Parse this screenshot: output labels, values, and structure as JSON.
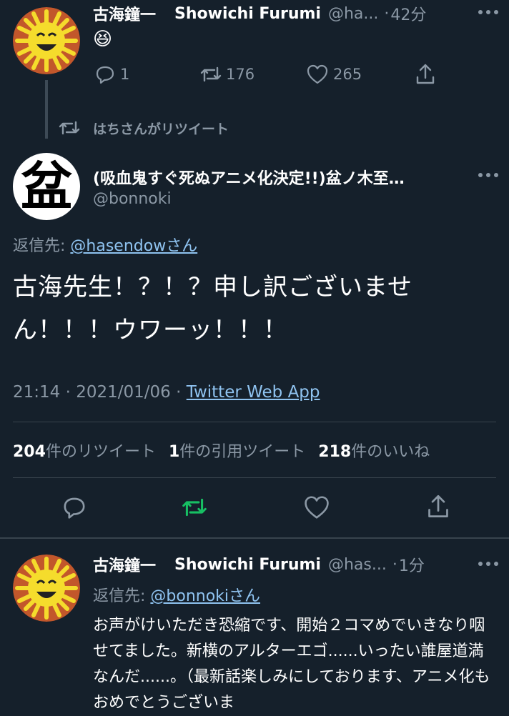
{
  "tweet1": {
    "author_name": "古海鐘一",
    "author_en": "Showichi Furumi",
    "handle": "@ha...",
    "sep": "·",
    "time": "42分",
    "text": "😆",
    "replies": "1",
    "retweets": "176",
    "likes": "265"
  },
  "retweet_banner": {
    "text": "はちさんがリツイート"
  },
  "main_tweet": {
    "author_name": "(吸血鬼すぐ死ぬアニメ化決定!!)盆ノ木至…",
    "handle": "@bonnoki",
    "avatar_char": "盆",
    "reply_prefix": "返信先: ",
    "reply_to": "@hasendowさん",
    "text": "古海先生！？！？申し訳ございません！！！ウワーッ！！！",
    "timestamp": "21:14 · 2021/01/06 · ",
    "source": "Twitter Web App",
    "stats": {
      "retweet_count": "204",
      "retweet_label": "件のリツイート",
      "quote_count": "1",
      "quote_label": "件の引用ツイート",
      "like_count": "218",
      "like_label": "件のいいね"
    }
  },
  "reply_tweet": {
    "author_name": "古海鐘一",
    "author_en": "Showichi Furumi",
    "handle": "@has...",
    "sep": "·",
    "time": "1分",
    "reply_prefix": "返信先: ",
    "reply_to": "@bonnokiさん",
    "text": "お声がけいただき恐縮です、開始２コマめでいきなり咽せてました。新横のアルターエゴ......いったい誰屋道満なんだ......。（最新話楽しみにしております、アニメ化もおめでとうございま"
  },
  "colors": {
    "background": "#15202b",
    "text": "#ffffff",
    "muted": "#8b98a5",
    "link": "#8fc3f0",
    "divider": "#38444d",
    "retweet_green": "#17bf63"
  }
}
